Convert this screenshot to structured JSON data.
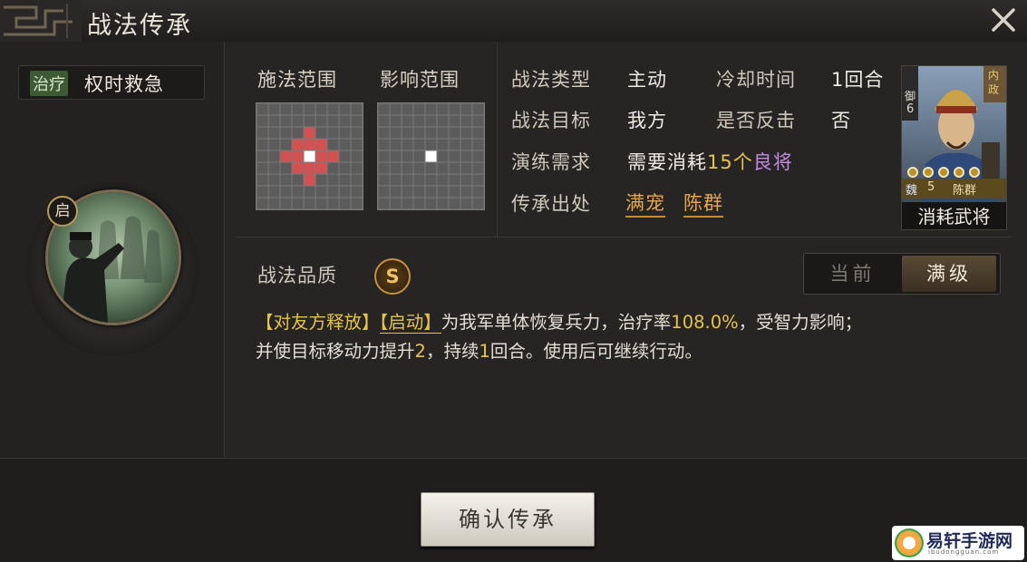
{
  "window": {
    "title": "战法传承"
  },
  "skill": {
    "type_tag": "治疗",
    "name": "权时救急",
    "activation_badge": "启"
  },
  "range": {
    "cast_label": "施法范围",
    "effect_label": "影响范围"
  },
  "info": {
    "type_label": "战法类型",
    "type_value": "主动",
    "cooldown_label": "冷却时间",
    "cooldown_value": "1回合",
    "target_label": "战法目标",
    "target_value": "我方",
    "counter_label": "是否反击",
    "counter_value": "否",
    "train_label": "演练需求",
    "train_prefix": "需要消耗",
    "train_count": "15个",
    "train_quality": "良将",
    "source_label": "传承出处",
    "source_names": [
      "满宠",
      "陈群"
    ]
  },
  "general_card": {
    "category": "内政",
    "troop_type": "御",
    "cost": "6",
    "faction": "魏",
    "level": "5",
    "name": "陈群",
    "caption": "消耗武将",
    "stars": 5
  },
  "quality": {
    "label": "战法品质",
    "grade": "S"
  },
  "level_toggle": {
    "current": "当前",
    "max": "满级",
    "selected": "满级"
  },
  "description": {
    "tag1": "【对友方释放】",
    "tag2": "【启动】",
    "text1": "为我军单体恢复兵力，治疗率",
    "rate": "108.0%",
    "text2": "，受智力影响；",
    "text3": "并使目标移动力提升",
    "move": "2",
    "text4": "，持续",
    "turns": "1",
    "text5": "回合。使用后可继续行动。"
  },
  "footer": {
    "confirm": "确认传承"
  },
  "watermark": {
    "text": "易轩手游网",
    "sub": "ibudongguan.com"
  },
  "colors": {
    "accent_gold": "#e7a64b",
    "highlight_yellow": "#e6c34d",
    "quality_purple": "#c28ae0",
    "range_red": "#d25252",
    "grid_gray": "#5c5c5c"
  }
}
